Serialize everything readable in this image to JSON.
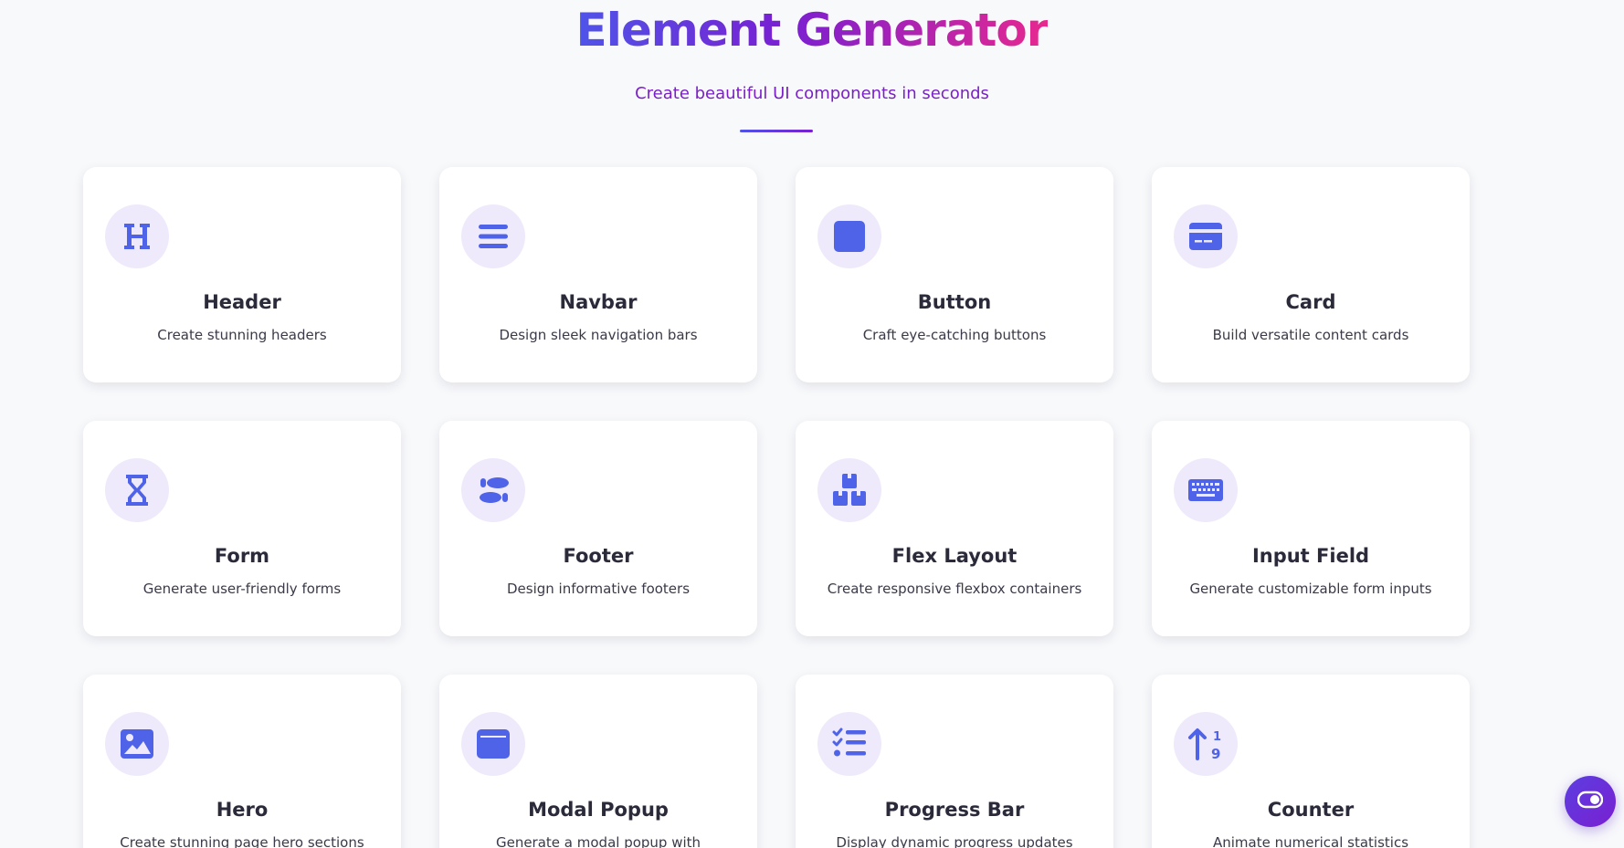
{
  "header": {
    "title": "Element Generator",
    "subtitle": "Create beautiful UI components in seconds"
  },
  "colors": {
    "accent": "#4f63e8",
    "icon_bg": "#efeafb",
    "title_gradient": [
      "#4f54e8",
      "#7a1fd1",
      "#e7288f"
    ],
    "subtitle": "#7a1fc6"
  },
  "cards": [
    {
      "title": "Header",
      "desc": "Create stunning headers",
      "icon": "heading-icon"
    },
    {
      "title": "Navbar",
      "desc": "Design sleek navigation bars",
      "icon": "bars-icon"
    },
    {
      "title": "Button",
      "desc": "Craft eye-catching buttons",
      "icon": "square-icon"
    },
    {
      "title": "Card",
      "desc": "Build versatile content cards",
      "icon": "credit-card-icon"
    },
    {
      "title": "Form",
      "desc": "Generate user-friendly forms",
      "icon": "hourglass-icon"
    },
    {
      "title": "Footer",
      "desc": "Design informative footers",
      "icon": "shoe-prints-icon"
    },
    {
      "title": "Flex Layout",
      "desc": "Create responsive flexbox containers",
      "icon": "boxes-icon"
    },
    {
      "title": "Input Field",
      "desc": "Generate customizable form inputs",
      "icon": "keyboard-icon"
    },
    {
      "title": "Hero",
      "desc": "Create stunning page hero sections",
      "icon": "image-icon"
    },
    {
      "title": "Modal Popup",
      "desc": "Generate a modal popup with",
      "icon": "window-icon"
    },
    {
      "title": "Progress Bar",
      "desc": "Display dynamic progress updates",
      "icon": "list-check-icon"
    },
    {
      "title": "Counter",
      "desc": "Animate numerical statistics",
      "icon": "sort-numeric-up-icon"
    }
  ],
  "fab": {
    "icon": "toggle-icon"
  }
}
